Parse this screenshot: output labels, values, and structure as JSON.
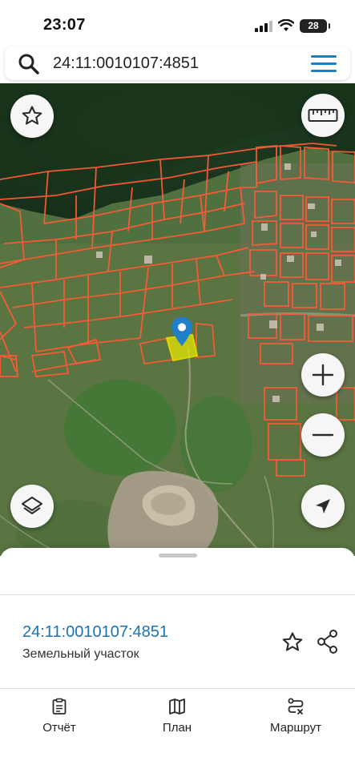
{
  "status_bar": {
    "time": "23:07",
    "battery": "28"
  },
  "search": {
    "value": "24:11:0010107:4851"
  },
  "map": {
    "selected_parcel_color": "#e6e600",
    "parcel_border_color": "#ff5a36",
    "pin_color": "#1f7fc9"
  },
  "sheet": {
    "parcel_number": "24:11:0010107:4851",
    "parcel_type": "Земельный участок",
    "tabs": [
      {
        "label": "Отчёт",
        "icon": "clipboard-icon"
      },
      {
        "label": "План",
        "icon": "map-icon"
      },
      {
        "label": "Маршрут",
        "icon": "route-icon"
      }
    ]
  },
  "colors": {
    "accent": "#1a7fc4",
    "link": "#1a73b5"
  }
}
